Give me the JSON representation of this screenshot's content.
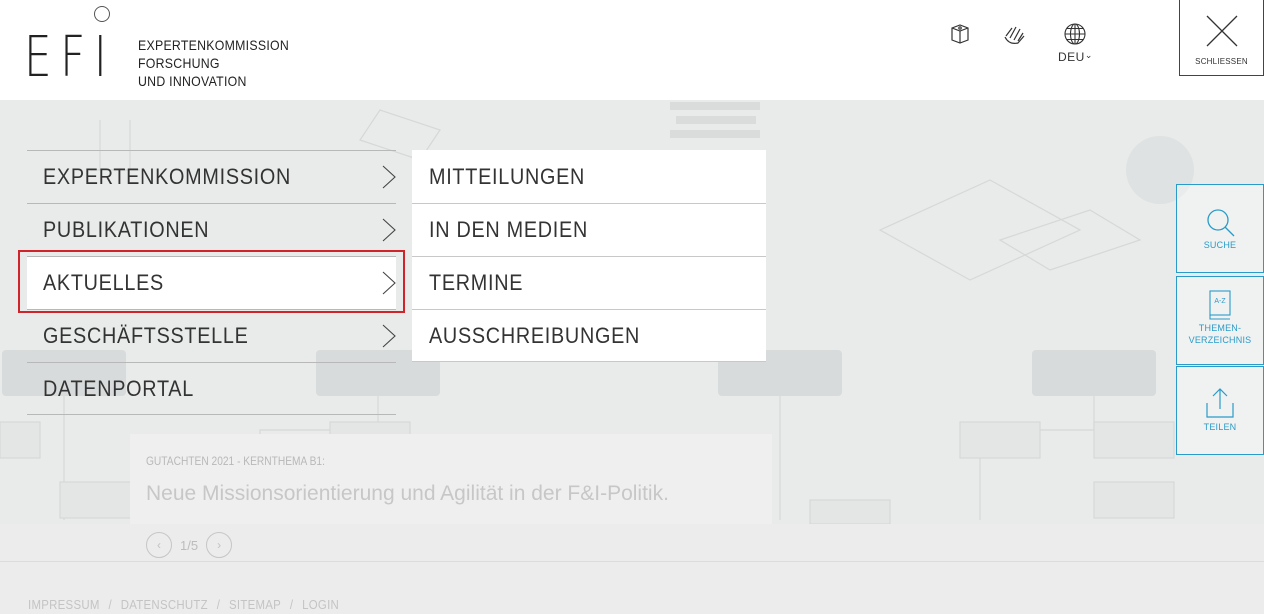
{
  "header": {
    "logo_mark": "EFI",
    "logo_lines": [
      "EXPERTENKOMMISSION",
      "FORSCHUNG",
      "UND INNOVATION"
    ],
    "icons": [
      "easy-language-icon",
      "sign-language-icon",
      "globe-icon"
    ],
    "language": "DEU",
    "close_label": "SCHLIESSEN"
  },
  "menu": {
    "items": [
      {
        "label": "EXPERTENKOMMISSION",
        "has_submenu": true
      },
      {
        "label": "PUBLIKATIONEN",
        "has_submenu": true
      },
      {
        "label": "AKTUELLES",
        "has_submenu": true
      },
      {
        "label": "GESCHÄFTSSTELLE",
        "has_submenu": true
      },
      {
        "label": "DATENPORTAL",
        "has_submenu": false
      }
    ],
    "active": "AKTUELLES"
  },
  "submenu": {
    "items": [
      "MITTEILUNGEN",
      "IN DEN MEDIEN",
      "TERMINE",
      "AUSSCHREIBUNGEN"
    ]
  },
  "tools": {
    "search": "SUCHE",
    "index": {
      "badge": "A-Z",
      "line1": "THEMEN-",
      "line2": "VERZEICHNIS"
    },
    "share": "TEILEN"
  },
  "slider": {
    "kicker": "GUTACHTEN 2021 - KERNTHEMA B1:",
    "title": "Neue Missionsorientierung und Agilität in der F&I-Politik.",
    "counter": "1/5"
  },
  "footer": {
    "links": [
      "IMPRESSUM",
      "DATENSCHUTZ",
      "SITEMAP",
      "LOGIN"
    ],
    "separator": "/"
  },
  "colors": {
    "accent": "#2a9bc8",
    "highlight": "#d0232a",
    "text": "#333333"
  }
}
